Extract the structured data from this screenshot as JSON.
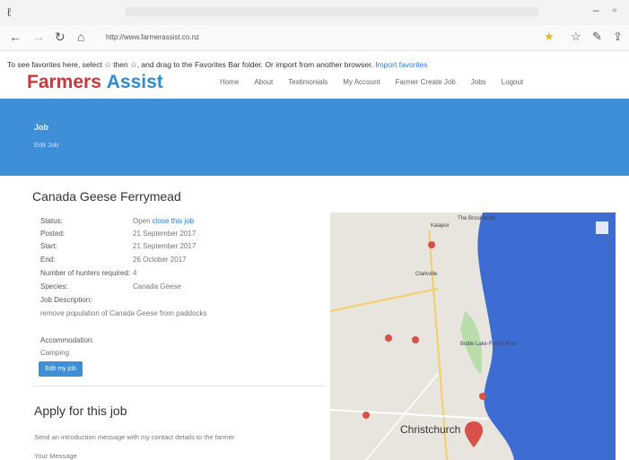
{
  "browser": {
    "url": "http://www.farmerassist.co.nz",
    "favorites_msg": "To see favorites here, select ☆ then ☆, and drag to the Favorites Bar folder. Or import from another browser.",
    "import_link": "Import favorites"
  },
  "site": {
    "brand_a": "Farmers ",
    "brand_b": "Assist",
    "nav": [
      "Home",
      "About",
      "Testimonials",
      "My Account",
      "Farmer Create Job",
      "Jobs",
      "Logout"
    ]
  },
  "hero": {
    "title": "Job",
    "subtitle": "Edit Job"
  },
  "job": {
    "title": "Canada Geese Ferrymead",
    "status_label": "Status:",
    "status_value": "Open",
    "close_link": "close this job",
    "posted_label": "Posted:",
    "posted_value": "21 September 2017",
    "start_label": "Start:",
    "start_value": "21 September 2017",
    "end_label": "End:",
    "end_value": "26 October 2017",
    "hunters_label": "Number of hunters required:",
    "hunters_value": "4",
    "species_label": "Species:",
    "species_value": "Canada Geese",
    "desc_label": "Job Description:",
    "desc_value": "remove population of Canada Geese from paddocks",
    "accom_label": "Accommodation:",
    "accom_value": "Camping",
    "edit_button": "Edit my job"
  },
  "apply": {
    "heading": "Apply for this job",
    "intro": "Send an introduction message with my contact details to the farmer",
    "message_label": "Your Message"
  },
  "map": {
    "labels": {
      "city": "Christchurch",
      "kaiapoi": "Kaiapoi",
      "clarkville": "Clarkville",
      "park": "Bottle Lake Forest Park",
      "spit": "The Brooklands"
    },
    "colors": {
      "sea": "#3d6cd2",
      "land": "#e7e5de",
      "green": "#b9dcaa",
      "pin": "#d8504a"
    }
  }
}
